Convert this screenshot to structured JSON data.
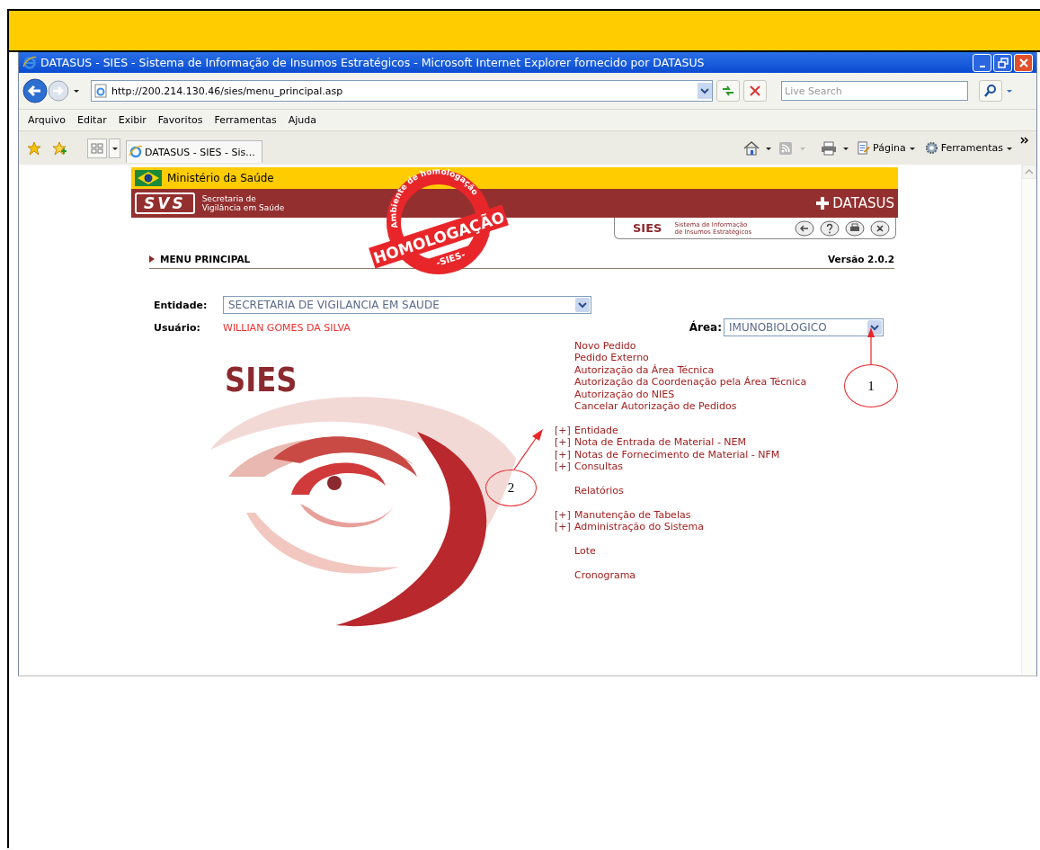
{
  "window": {
    "title": "DATASUS - SIES - Sistema de Informação de Insumos Estratégicos - Microsoft Internet Explorer fornecido por DATASUS"
  },
  "address_bar": {
    "url": "http://200.214.130.46/sies/menu_principal.asp",
    "search_placeholder": "Live Search"
  },
  "menu_bar": [
    "Arquivo",
    "Editar",
    "Exibir",
    "Favoritos",
    "Ferramentas",
    "Ajuda"
  ],
  "tab": {
    "label": "DATASUS - SIES - Sis..."
  },
  "command_bar": {
    "page": "Página",
    "tools": "Ferramentas"
  },
  "site": {
    "ministry": "Ministério da Saúde",
    "svs_logo": "SVS",
    "svs_line1": "Secretaria de",
    "svs_line2": "Vigilância em Saúde",
    "datasus": "DATASUS",
    "sies_label": "SIES",
    "sies_desc1": "Sistema de Informação",
    "sies_desc2": "de Insumos Estratégicos",
    "menu_title": "MENU PRINCIPAL",
    "version": "Versão 2.0.2"
  },
  "stamp": {
    "arc_text": "Ambiente de homologação",
    "main": "HOMOLOGAÇÃO",
    "sub": "-SIES-"
  },
  "form": {
    "entity_label": "Entidade:",
    "entity_value": "SECRETARIA DE VIGILANCIA EM SAUDE",
    "user_label": "Usuário:",
    "user_value": "WILLIAN GOMES DA SILVA",
    "area_label": "Área:",
    "area_value": "IMUNOBIOLOGICO"
  },
  "logo": {
    "text": "SIES"
  },
  "menu_sections": [
    [
      {
        "kind": "link",
        "label": "Novo Pedido"
      },
      {
        "kind": "link",
        "label": "Pedido Externo"
      },
      {
        "kind": "link",
        "label": "Autorização da Área Técnica"
      },
      {
        "kind": "link",
        "label": "Autorização da Coordenação pela Área Técnica"
      },
      {
        "kind": "link",
        "label": "Autorização do NIES"
      },
      {
        "kind": "link",
        "label": "Cancelar Autorização de Pedidos"
      }
    ],
    [
      {
        "kind": "group",
        "marker": "[+]",
        "label": "Entidade"
      },
      {
        "kind": "group",
        "marker": "[+]",
        "label": "Nota de Entrada de Material - NEM"
      },
      {
        "kind": "group",
        "marker": "[+]",
        "label": "Notas de Fornecimento de Material - NFM"
      },
      {
        "kind": "group",
        "marker": "[+]",
        "label": "Consultas"
      }
    ],
    [
      {
        "kind": "link",
        "label": "Relatórios"
      }
    ],
    [
      {
        "kind": "group",
        "marker": "[+]",
        "label": "Manutenção de Tabelas"
      },
      {
        "kind": "group",
        "marker": "[+]",
        "label": "Administração do Sistema"
      }
    ],
    [
      {
        "kind": "link",
        "label": "Lote"
      }
    ],
    [
      {
        "kind": "link",
        "label": "Cronograma"
      }
    ]
  ],
  "annotations": [
    {
      "label": "1"
    },
    {
      "label": "2"
    }
  ]
}
